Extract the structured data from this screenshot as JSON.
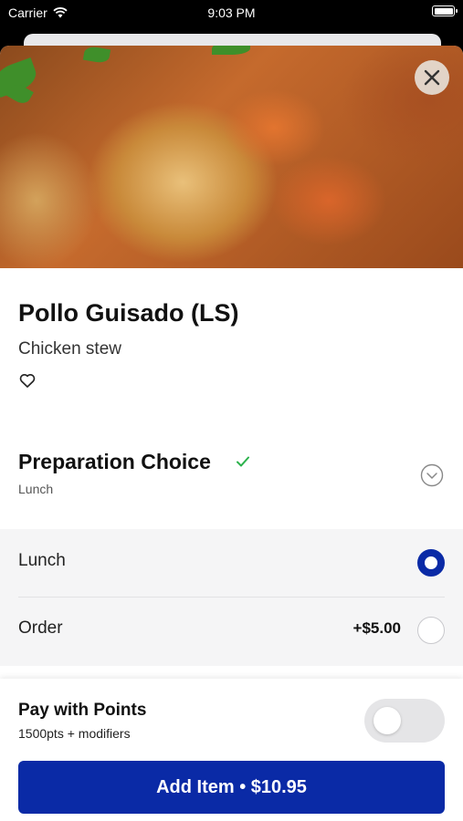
{
  "status_bar": {
    "carrier": "Carrier",
    "time": "9:03 PM",
    "battery_level": 1.0
  },
  "item": {
    "name": "Pollo Guisado (LS)",
    "description": "Chicken stew",
    "favorite_icon": "heart-outline-icon",
    "close_icon": "close-icon"
  },
  "preparation": {
    "title": "Preparation Choice",
    "selected": "Lunch",
    "status_icon": "check-icon",
    "status_color": "#2bb24c",
    "expand_icon": "chevron-down-circle-icon",
    "options": [
      {
        "label": "Lunch",
        "price": "",
        "selected": true
      },
      {
        "label": "Order",
        "price": "+$5.00",
        "selected": false
      }
    ]
  },
  "points": {
    "title": "Pay with Points",
    "subtitle": "1500pts + modifiers",
    "enabled": false
  },
  "add_button": {
    "label": "Add Item • $10.95"
  },
  "colors": {
    "accent": "#0a2aa6"
  }
}
